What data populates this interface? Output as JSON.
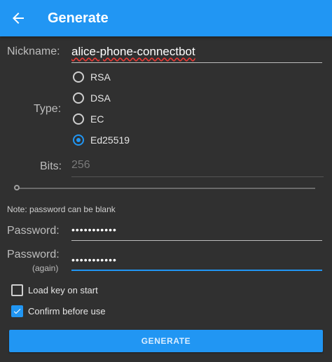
{
  "appbar": {
    "title": "Generate",
    "back_icon": "arrow-left-icon"
  },
  "form": {
    "nickname": {
      "label": "Nickname:",
      "value": "alice-phone-connectbot"
    },
    "type": {
      "label": "Type:",
      "options": [
        {
          "label": "RSA",
          "selected": false
        },
        {
          "label": "DSA",
          "selected": false
        },
        {
          "label": "EC",
          "selected": false
        },
        {
          "label": "Ed25519",
          "selected": true
        }
      ]
    },
    "bits": {
      "label": "Bits:",
      "value": "256"
    },
    "note": "Note: password can be blank",
    "password": {
      "label": "Password:",
      "value": "•••••••••••"
    },
    "password_again": {
      "label": "Password:",
      "sublabel": "(again)",
      "value": "•••••••••••"
    },
    "load_key_on_start": {
      "label": "Load key on start",
      "checked": false
    },
    "confirm_before_use": {
      "label": "Confirm before use",
      "checked": true
    },
    "generate_button": "GENERATE"
  },
  "colors": {
    "accent": "#2196f3",
    "background": "#303030",
    "error_underline": "#e53935"
  }
}
